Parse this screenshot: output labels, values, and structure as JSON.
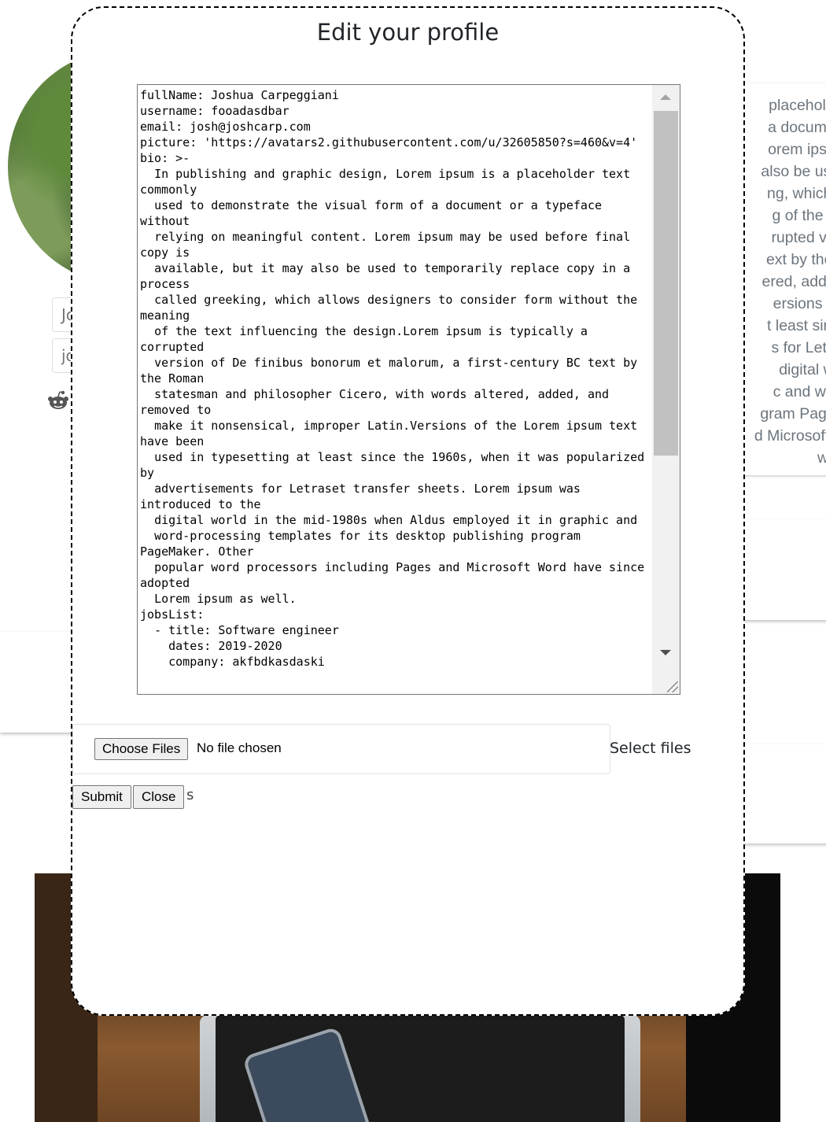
{
  "background": {
    "name_input_fragment": "Jo",
    "username_input_fragment": "jo",
    "bio_card_lines": [
      "placeholder",
      "a document",
      "orem ipsum",
      "also be used",
      "ng, which al",
      "g of the tex",
      "rupted vers",
      "ext by the R",
      "ered, added,",
      "ersions of t",
      "t least since",
      "s for Letras",
      "digital wor",
      "c and word",
      "gram PageM",
      "d Microsoft W",
      "well."
    ]
  },
  "modal": {
    "title": "Edit your profile",
    "yaml_text": "fullName: Joshua Carpeggiani\nusername: fooadasdbar\nemail: josh@joshcarp.com\npicture: 'https://avatars2.githubusercontent.com/u/32605850?s=460&v=4'\nbio: >-\n  In publishing and graphic design, Lorem ipsum is a placeholder text commonly\n  used to demonstrate the visual form of a document or a typeface without\n  relying on meaningful content. Lorem ipsum may be used before final copy is\n  available, but it may also be used to temporarily replace copy in a process\n  called greeking, which allows designers to consider form without the meaning\n  of the text influencing the design.Lorem ipsum is typically a corrupted\n  version of De finibus bonorum et malorum, a first-century BC text by the Roman\n  statesman and philosopher Cicero, with words altered, added, and removed to\n  make it nonsensical, improper Latin.Versions of the Lorem ipsum text have been\n  used in typesetting at least since the 1960s, when it was popularized by\n  advertisements for Letraset transfer sheets. Lorem ipsum was introduced to the\n  digital world in the mid-1980s when Aldus employed it in graphic and\n  word-processing templates for its desktop publishing program PageMaker. Other\n  popular word processors including Pages and Microsoft Word have since adopted\n  Lorem ipsum as well.\njobsList:\n  - title: Software engineer\n    dates: 2019-2020\n    company: akfbdkasdaski",
    "file_button_label": "Choose Files",
    "file_status": "No file chosen",
    "file_label": "Select files",
    "submit_label": "Submit",
    "close_label": "Close",
    "leftover_text": "s"
  }
}
